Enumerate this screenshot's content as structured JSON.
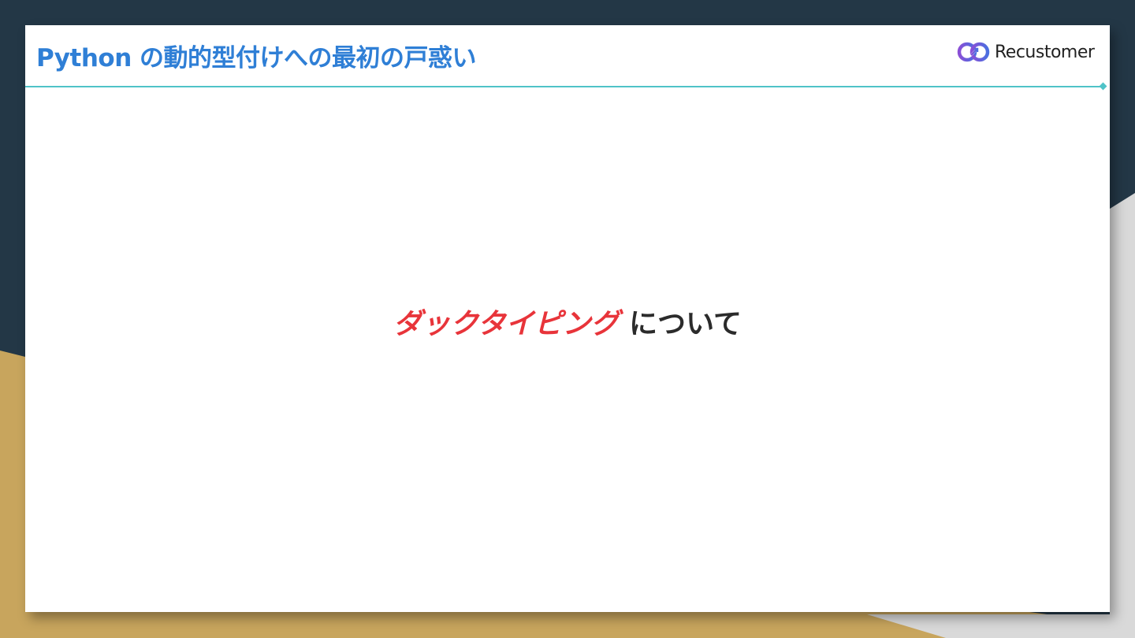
{
  "slide": {
    "title": "Python の動的型付けへの最初の戸惑い",
    "logo_text": "Recustomer",
    "highlight": "ダックタイピング",
    "rest": " について"
  },
  "colors": {
    "title": "#2f7fd6",
    "highlight": "#e8343a",
    "rule": "#4fc3c8",
    "bg_dark": "#233746",
    "bg_gold": "#c8a55d"
  }
}
